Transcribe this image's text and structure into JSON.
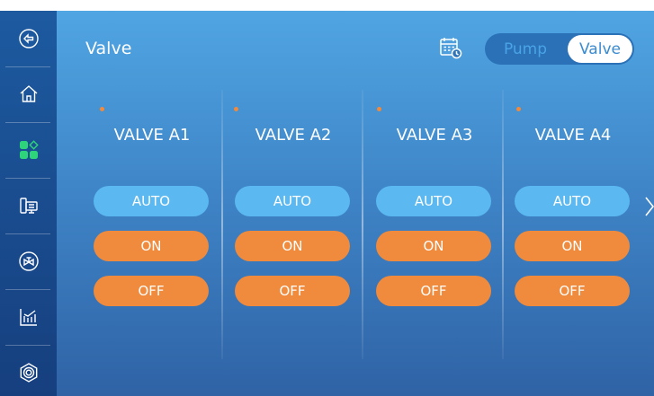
{
  "sidebar": {
    "items": [
      {
        "icon": "back-icon"
      },
      {
        "icon": "home-icon"
      },
      {
        "icon": "apps-icon",
        "active": true,
        "active_color": "#2ed47a"
      },
      {
        "icon": "monitor-icon"
      },
      {
        "icon": "valve-icon"
      },
      {
        "icon": "chart-icon"
      },
      {
        "icon": "settings-icon"
      }
    ]
  },
  "header": {
    "title": "Valve",
    "schedule_icon": "calendar-icon",
    "segment": {
      "options": [
        "Pump",
        "Valve"
      ],
      "selected": "Valve"
    }
  },
  "valves": [
    {
      "name": "VALVE A1",
      "auto_label": "AUTO",
      "on_label": "ON",
      "off_label": "OFF"
    },
    {
      "name": "VALVE A2",
      "auto_label": "AUTO",
      "on_label": "ON",
      "off_label": "OFF"
    },
    {
      "name": "VALVE A3",
      "auto_label": "AUTO",
      "on_label": "ON",
      "off_label": "OFF"
    },
    {
      "name": "VALVE A4",
      "auto_label": "AUTO",
      "on_label": "ON",
      "off_label": "OFF"
    }
  ],
  "colors": {
    "auto": "#5bb8f0",
    "on": "#f08a3c",
    "off": "#f08a3c",
    "status_dot": "#f3893a",
    "sidebar": "#1d5aa0"
  },
  "navigation": {
    "next_icon": "chevron-right-icon"
  }
}
